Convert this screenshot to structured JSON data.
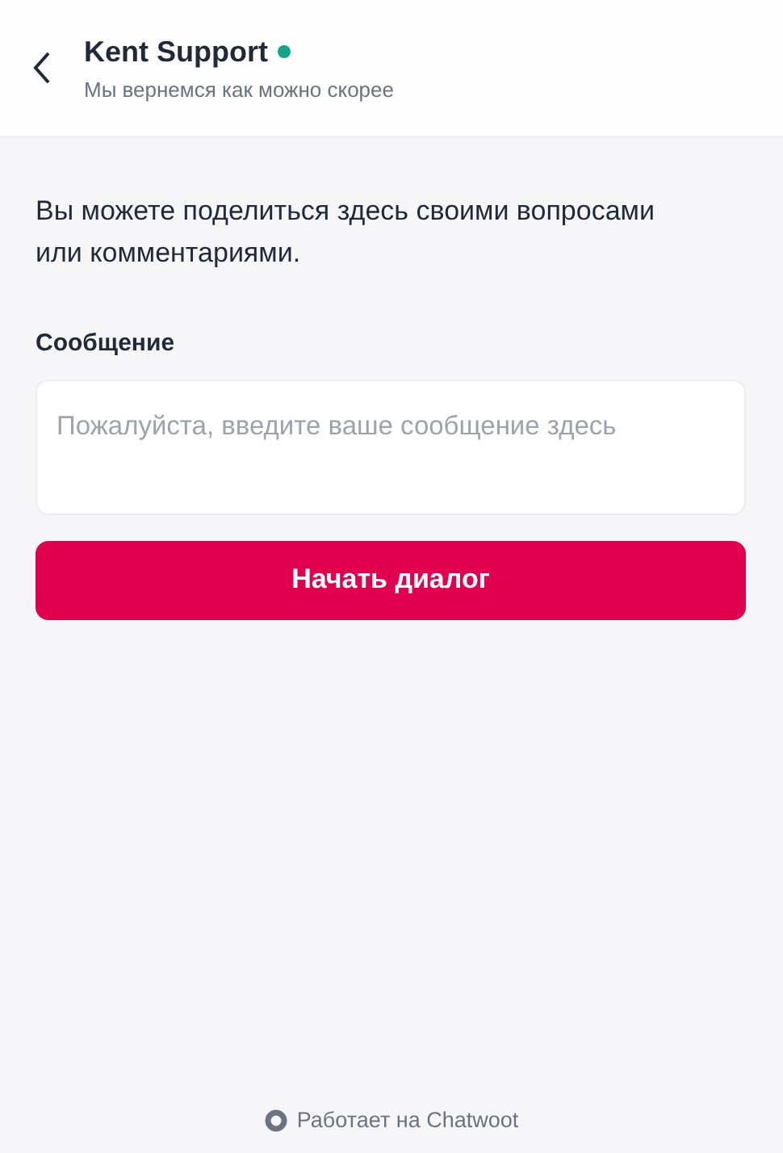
{
  "header": {
    "title": "Kent Support",
    "online": true,
    "subtitle": "Мы вернемся как можно скорее"
  },
  "intro": "Вы можете поделиться здесь своими вопросами или комментариями.",
  "message": {
    "label": "Сообщение",
    "placeholder": "Пожалуйста, введите ваше сообщение здесь"
  },
  "start_button": "Начать диалог",
  "footer": "Работает на Chatwoot"
}
